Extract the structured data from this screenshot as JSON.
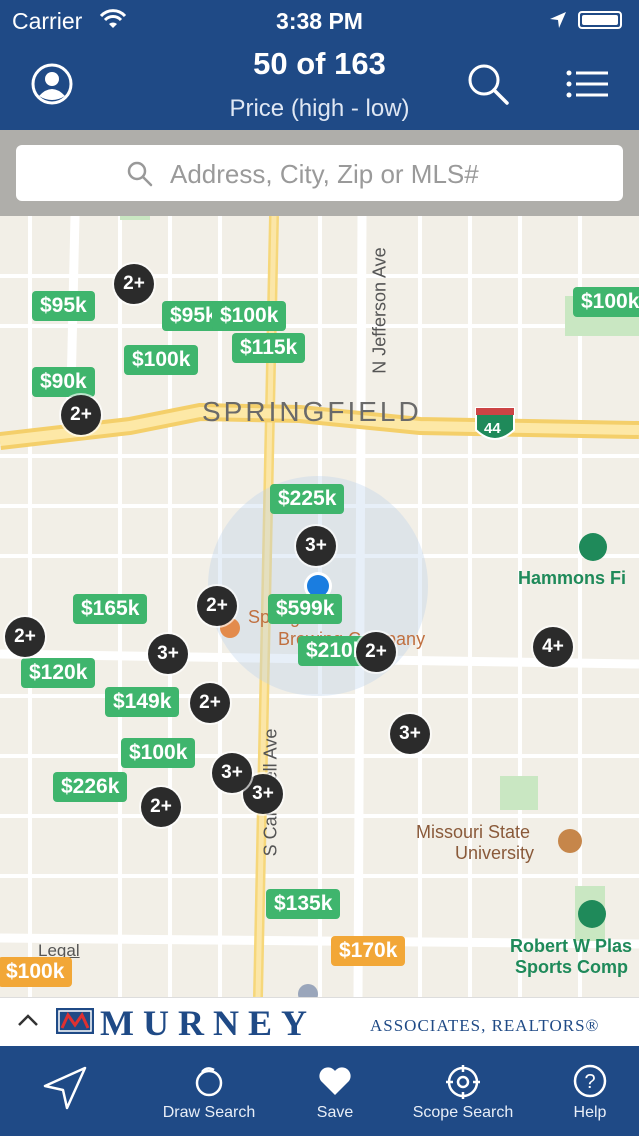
{
  "status": {
    "carrier": "Carrier",
    "time": "3:38 PM"
  },
  "header": {
    "title": "50 of 163",
    "subtitle": "Price (high - low)"
  },
  "search": {
    "placeholder": "Address, City, Zip or MLS#"
  },
  "map": {
    "city_label": "SPRINGFIELD",
    "street_jefferson": "N Jefferson Ave",
    "street_campbell": "S Campbell Ave",
    "interstate": "44",
    "legal": "Legal",
    "poi_hammons": "Hammons Fi",
    "poi_missouri_1": "Missouri State",
    "poi_missouri_2": "University",
    "poi_robert_1": "Robert W Plas",
    "poi_robert_2": "Sports Comp",
    "poi_brewery_1": "Springfield",
    "poi_brewery_2": "Brewing Company",
    "prices": [
      "$95k",
      "$95k",
      "$100k",
      "$115k",
      "$100k",
      "$90k",
      "$100k",
      "$225k",
      "$165k",
      "$599k",
      "$210k",
      "$120k",
      "$149k",
      "$100k",
      "$226k",
      "$135k",
      "$170k",
      "$100k"
    ],
    "clusters": [
      "2+",
      "2+",
      "3+",
      "2+",
      "2+",
      "3+",
      "2+",
      "4+",
      "3+",
      "2+",
      "3+",
      "2+"
    ]
  },
  "brand": {
    "name": "MURNEY",
    "suffix": "ASSOCIATES, REALTORS®"
  },
  "tabs": [
    {
      "label": ""
    },
    {
      "label": "Draw Search"
    },
    {
      "label": "Save"
    },
    {
      "label": "Scope Search"
    },
    {
      "label": "Help"
    }
  ],
  "colors": {
    "header": "#1f4a86",
    "price_marker": "#3fb56d",
    "price_marker_alt": "#f2a737",
    "cluster": "#2b2b2b",
    "location": "#1a7de0"
  },
  "icons": {
    "profile": "profile-icon",
    "search": "search-icon",
    "menu": "menu-icon",
    "locate": "location-arrow-icon",
    "draw": "draw-search-icon",
    "save": "heart-icon",
    "scope": "scope-icon",
    "help": "help-icon"
  }
}
